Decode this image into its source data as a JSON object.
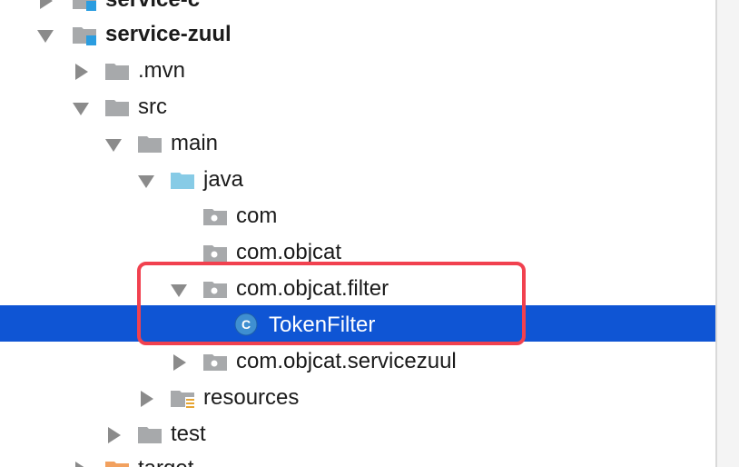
{
  "tree": {
    "items": [
      {
        "label": "service-c",
        "expanded": false,
        "icon": "module-folder-icon"
      },
      {
        "label": "service-zuul",
        "expanded": true,
        "icon": "module-folder-icon"
      },
      {
        "label": ".mvn",
        "expanded": false,
        "icon": "folder-icon"
      },
      {
        "label": "src",
        "expanded": true,
        "icon": "folder-icon"
      },
      {
        "label": "main",
        "expanded": true,
        "icon": "folder-icon"
      },
      {
        "label": "java",
        "expanded": true,
        "icon": "source-folder-icon"
      },
      {
        "label": "com",
        "expanded": false,
        "icon": "package-icon"
      },
      {
        "label": "com.objcat",
        "expanded": false,
        "icon": "package-icon"
      },
      {
        "label": "com.objcat.filter",
        "expanded": true,
        "icon": "package-icon"
      },
      {
        "label": "TokenFilter",
        "selected": true,
        "icon": "class-icon"
      },
      {
        "label": "com.objcat.servicezuul",
        "expanded": false,
        "icon": "package-icon"
      },
      {
        "label": "resources",
        "expanded": false,
        "icon": "resources-folder-icon"
      },
      {
        "label": "test",
        "expanded": false,
        "icon": "folder-icon"
      },
      {
        "label": "target",
        "expanded": false,
        "icon": "excluded-folder-icon"
      }
    ]
  },
  "colors": {
    "selection": "#0f55d4",
    "highlight_border": "#f1414f",
    "folder_gray": "#a7a9ab",
    "source_blue": "#87cbe6",
    "class_blue": "#3f8fd1",
    "target_orange": "#f2a15f"
  }
}
